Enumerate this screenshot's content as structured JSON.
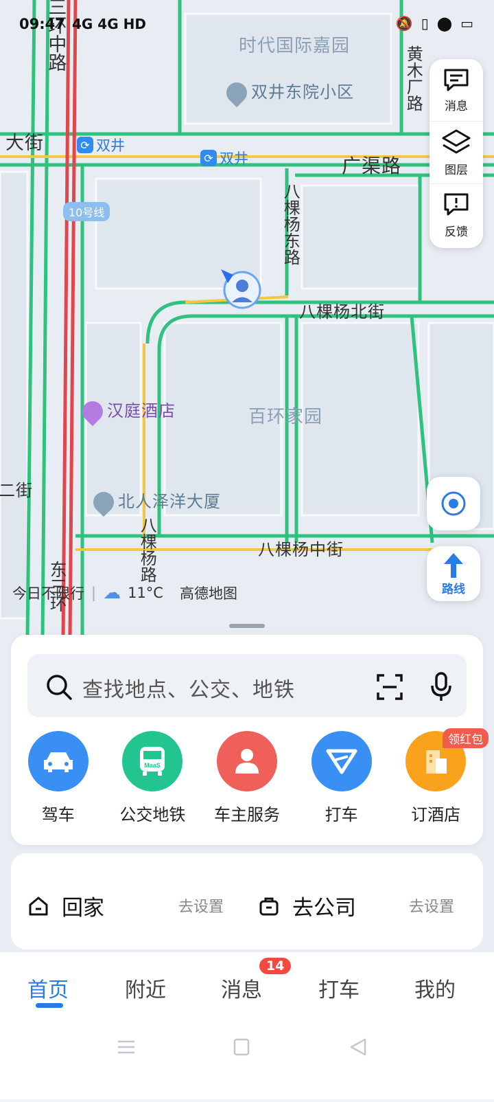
{
  "status": {
    "time": "09:47",
    "network": "4G 4G HD"
  },
  "map": {
    "roads": [
      "三环中路",
      "大街",
      "广渠路",
      "八棵杨东路",
      "八棵杨北街",
      "八棵杨中街",
      "八棵杨路",
      "东三环",
      "黄木厂路",
      "二街"
    ],
    "pois": [
      "时代国际嘉园",
      "双井东院小区",
      "汉庭酒店",
      "北人泽洋大厦",
      "百环家园"
    ],
    "subway_stations": [
      "双井",
      "双井"
    ],
    "line_tag": "10号线"
  },
  "tools": {
    "messages": "消息",
    "layers": "图层",
    "feedback": "反馈"
  },
  "route_label": "路线",
  "info": {
    "restriction": "今日不限行",
    "weather": "11°C",
    "brand": "高德地图"
  },
  "search": {
    "placeholder": "查找地点、公交、地铁"
  },
  "services": [
    {
      "label": "驾车",
      "color": "#3a8ff5"
    },
    {
      "label": "公交地铁",
      "color": "#22c58f"
    },
    {
      "label": "车主服务",
      "color": "#f0605a"
    },
    {
      "label": "打车",
      "color": "#3a8ff5"
    },
    {
      "label": "订酒店",
      "color": "#f9a21b",
      "badge": "领红包"
    }
  ],
  "shortcuts": {
    "home": {
      "label": "回家",
      "action": "去设置"
    },
    "work": {
      "label": "去公司",
      "action": "去设置"
    }
  },
  "tabs": [
    "首页",
    "附近",
    "消息",
    "打车",
    "我的"
  ],
  "message_badge": "14",
  "accent": "#2a7be4"
}
